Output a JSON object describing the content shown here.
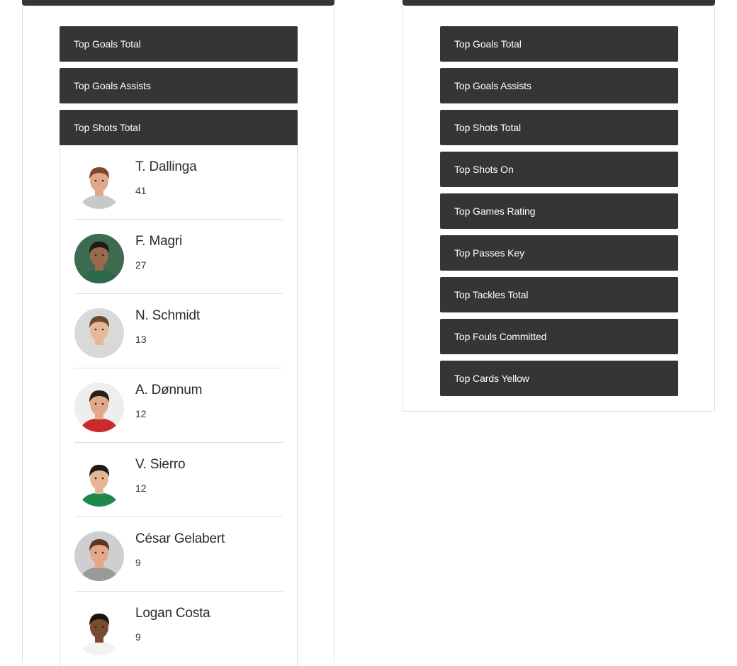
{
  "left_panel": {
    "menu": [
      {
        "label": "Top Goals Total"
      },
      {
        "label": "Top Goals Assists"
      },
      {
        "label": "Top Shots Total"
      }
    ],
    "expanded": {
      "players": [
        {
          "name": "T. Dallinga",
          "value": "41",
          "skin": "#e0a78a",
          "hair": "#7a4a2a",
          "shirt": "#c8c8c8",
          "bg": "#ffffff"
        },
        {
          "name": "F. Magri",
          "value": "27",
          "skin": "#9a6a4a",
          "hair": "#1e1a18",
          "shirt": "#2a6a4a",
          "bg": "#3d6b4f"
        },
        {
          "name": "N. Schmidt",
          "value": "13",
          "skin": "#e8b79a",
          "hair": "#6a4a2a",
          "shirt": "#d8d8d8",
          "bg": "#d9d9d9"
        },
        {
          "name": "A. Dønnum",
          "value": "12",
          "skin": "#e2a88a",
          "hair": "#2a1e18",
          "shirt": "#cc2a2a",
          "bg": "#eeeeee"
        },
        {
          "name": "V. Sierro",
          "value": "12",
          "skin": "#e6b596",
          "hair": "#1e1a18",
          "shirt": "#1e8a4a",
          "bg": "#ffffff"
        },
        {
          "name": "César Gelabert",
          "value": "9",
          "skin": "#e2a888",
          "hair": "#5a3a22",
          "shirt": "#9a9a9a",
          "bg": "#cfcfcf"
        },
        {
          "name": "Logan Costa",
          "value": "9",
          "skin": "#7a4a32",
          "hair": "#1a1412",
          "shirt": "#f2f2f2",
          "bg": "#ffffff"
        }
      ]
    }
  },
  "right_panel": {
    "menu": [
      {
        "label": "Top Goals Total"
      },
      {
        "label": "Top Goals Assists"
      },
      {
        "label": "Top Shots Total"
      },
      {
        "label": "Top Shots On"
      },
      {
        "label": "Top Games Rating"
      },
      {
        "label": "Top Passes Key"
      },
      {
        "label": "Top Tackles Total"
      },
      {
        "label": "Top Fouls Committed"
      },
      {
        "label": "Top Cards Yellow"
      }
    ]
  },
  "colors": {
    "menu_bg": "#353535",
    "menu_text": "#ffffff",
    "divider": "#dedede"
  }
}
